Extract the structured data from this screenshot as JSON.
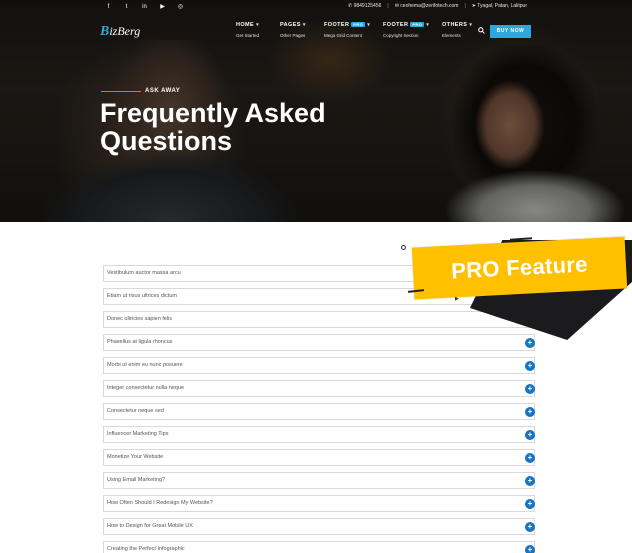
{
  "topbar": {
    "social_icons": [
      "facebook-icon",
      "twitter-icon",
      "linkedin-icon",
      "youtube-icon",
      "instagram-icon"
    ],
    "social_glyphs": [
      "f",
      "t",
      "in",
      "▶",
      "◎"
    ],
    "phone": "✆ 9849125456",
    "email": "✉ ceohema@zerifotech.com",
    "location": "➤ Tyagal, Patan, Lalitpur"
  },
  "nav": {
    "logo_prefix": "B",
    "logo_rest": "izBerg",
    "items": [
      {
        "label": "HOME",
        "sub": "Get Started"
      },
      {
        "label": "PAGES",
        "sub": "Other Pages"
      },
      {
        "label": "FOOTER",
        "badge": "PRO",
        "sub": "Mega Grid Content"
      },
      {
        "label": "FOOTER",
        "badge": "PRO",
        "sub": "Copyright Section"
      },
      {
        "label": "OTHERS",
        "sub": "Elements"
      }
    ],
    "buy_label": "BUY NOW"
  },
  "hero": {
    "kicker": "ASK AWAY",
    "title": "Frequently Asked Questions"
  },
  "pro_badge": "PRO Feature",
  "faq": {
    "items": [
      "Vestibulum auctor massa arcu",
      "Etiam ut risus ultrices dictum",
      "Donec ultricies sapien felis",
      "Phasellus at ligula rhoncus",
      "Morbi ut enim eu nunc posuere",
      "Integer consectetur nulla neque",
      "Consectetur neque sed",
      "Influencer Marketing Tips",
      "Monetize Your Website",
      "Using Email Marketing?",
      "How Often Should I Redesign My Website?",
      "How to Design for Great Mobile UX",
      "Creating the Perfect Infographic"
    ]
  },
  "colors": {
    "accent": "#2aa8df",
    "plus_button": "#1674c1",
    "pro_badge": "#ffc000"
  }
}
